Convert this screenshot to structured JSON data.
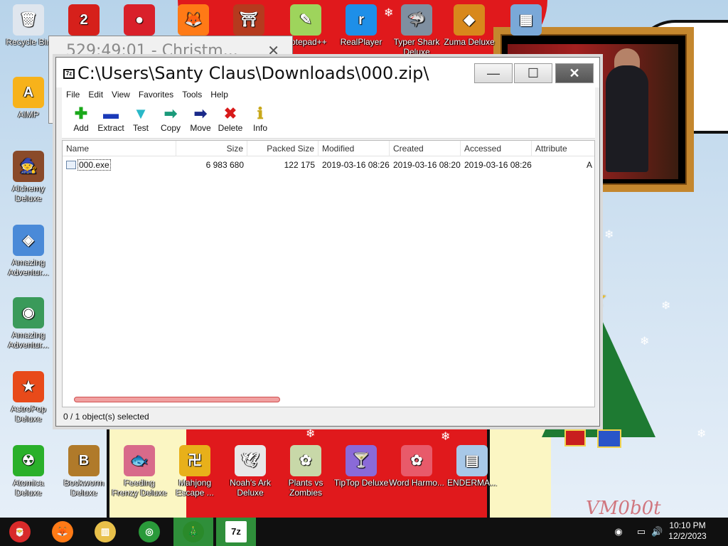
{
  "desktop_icons_top": [
    {
      "label": "Recycle Bin",
      "glyph": "🗑",
      "color": "#dfe6ee"
    },
    {
      "label": "",
      "glyph": "2",
      "color": "#d6201b"
    },
    {
      "label": "",
      "glyph": "●",
      "color": "#d9202a"
    },
    {
      "label": "",
      "glyph": "🦊",
      "color": "#ff7a16"
    },
    {
      "label": "",
      "glyph": "⛩",
      "color": "#b53a1e"
    },
    {
      "label": "Notepad++",
      "glyph": "✎",
      "color": "#9ed45c"
    },
    {
      "label": "RealPlayer",
      "glyph": "r",
      "color": "#1e8fe8"
    },
    {
      "label": "Typer Shark Deluxe",
      "glyph": "🦈",
      "color": "#7f8fa0"
    },
    {
      "label": "Zuma Deluxe",
      "glyph": "◆",
      "color": "#d8881c"
    },
    {
      "label": "",
      "glyph": "▦",
      "color": "#7aa8d8"
    }
  ],
  "desktop_icons_left": [
    {
      "label": "AIMP",
      "glyph": "A",
      "color": "#f7b21a"
    },
    {
      "label": "Alchemy Deluxe",
      "glyph": "🧙",
      "color": "#8a4a2a"
    },
    {
      "label": "Amazing Adventur...",
      "glyph": "◈",
      "color": "#4a8ad8"
    },
    {
      "label": "Amazing Adventur...",
      "glyph": "◉",
      "color": "#3a9a5a"
    },
    {
      "label": "AstroPop Deluxe",
      "glyph": "★",
      "color": "#e84a1a"
    }
  ],
  "desktop_icons_bottom": [
    {
      "label": "Atomica Deluxe",
      "glyph": "☢",
      "color": "#2ab02a"
    },
    {
      "label": "Bookworm Deluxe",
      "glyph": "B",
      "color": "#b07a2a"
    },
    {
      "label": "Feeding Frenzy Deluxe",
      "glyph": "🐟",
      "color": "#d86a8a"
    },
    {
      "label": "Mahjong Escape ...",
      "glyph": "卍",
      "color": "#e8b01a"
    },
    {
      "label": "Noah's Ark Deluxe",
      "glyph": "🕊",
      "color": "#e8e8e8"
    },
    {
      "label": "Plants vs Zombies",
      "glyph": "✿",
      "color": "#c8d8a8"
    },
    {
      "label": "TipTop Deluxe",
      "glyph": "🍸",
      "color": "#8a6ad8"
    },
    {
      "label": "Word Harmo...",
      "glyph": "✿",
      "color": "#e85a6a"
    },
    {
      "label": "ENDERMA...",
      "glyph": "▤",
      "color": "#a8c8e8"
    }
  ],
  "bg_window": {
    "title": "529:49:01 - Christm...",
    "close": "✕"
  },
  "window": {
    "title": "C:\\Users\\Santy Claus\\Downloads\\000.zip\\",
    "app_icon": "7z",
    "min": "—",
    "max": "☐",
    "close": "✕",
    "menu": [
      "File",
      "Edit",
      "View",
      "Favorites",
      "Tools",
      "Help"
    ],
    "toolbar": [
      {
        "label": "Add",
        "glyph": "✚",
        "color": "#1aa81a"
      },
      {
        "label": "Extract",
        "glyph": "▬",
        "color": "#1a3ab8"
      },
      {
        "label": "Test",
        "glyph": "▼",
        "color": "#2ab8c8"
      },
      {
        "label": "Copy",
        "glyph": "➡",
        "color": "#1a9a7a"
      },
      {
        "label": "Move",
        "glyph": "➡",
        "color": "#1a2a8a"
      },
      {
        "label": "Delete",
        "glyph": "✖",
        "color": "#d81a1a"
      },
      {
        "label": "Info",
        "glyph": "ℹ",
        "color": "#c8a81a"
      }
    ],
    "columns": [
      "Name",
      "Size",
      "Packed Size",
      "Modified",
      "Created",
      "Accessed",
      "Attribute"
    ],
    "rows": [
      [
        "000.exe",
        "6 983 680",
        "122 175",
        "2019-03-16 08:26",
        "2019-03-16 08:20",
        "2019-03-16 08:26",
        "A"
      ]
    ],
    "status": "0 / 1 object(s) selected"
  },
  "taskbar": {
    "time": "10:10 PM",
    "date": "12/2/2023",
    "items": [
      {
        "name": "start",
        "glyph": "🎅",
        "color": "#d82a2a"
      },
      {
        "name": "firefox",
        "glyph": "🦊",
        "color": "#ff7a16"
      },
      {
        "name": "file-explorer",
        "glyph": "▥",
        "color": "#e8c04a"
      },
      {
        "name": "chrome",
        "glyph": "◎",
        "color": "#2a9a3a"
      },
      {
        "name": "christmas-tree",
        "glyph": "🎄",
        "color": "#2a8a2a"
      },
      {
        "name": "7zip",
        "glyph": "7z",
        "color": "#111111"
      }
    ]
  },
  "watermark": "VM0b0t",
  "colors": {
    "wallpaper_red": "#e0191c",
    "taskbar": "#101010",
    "active_task": "#2f8f3a"
  }
}
